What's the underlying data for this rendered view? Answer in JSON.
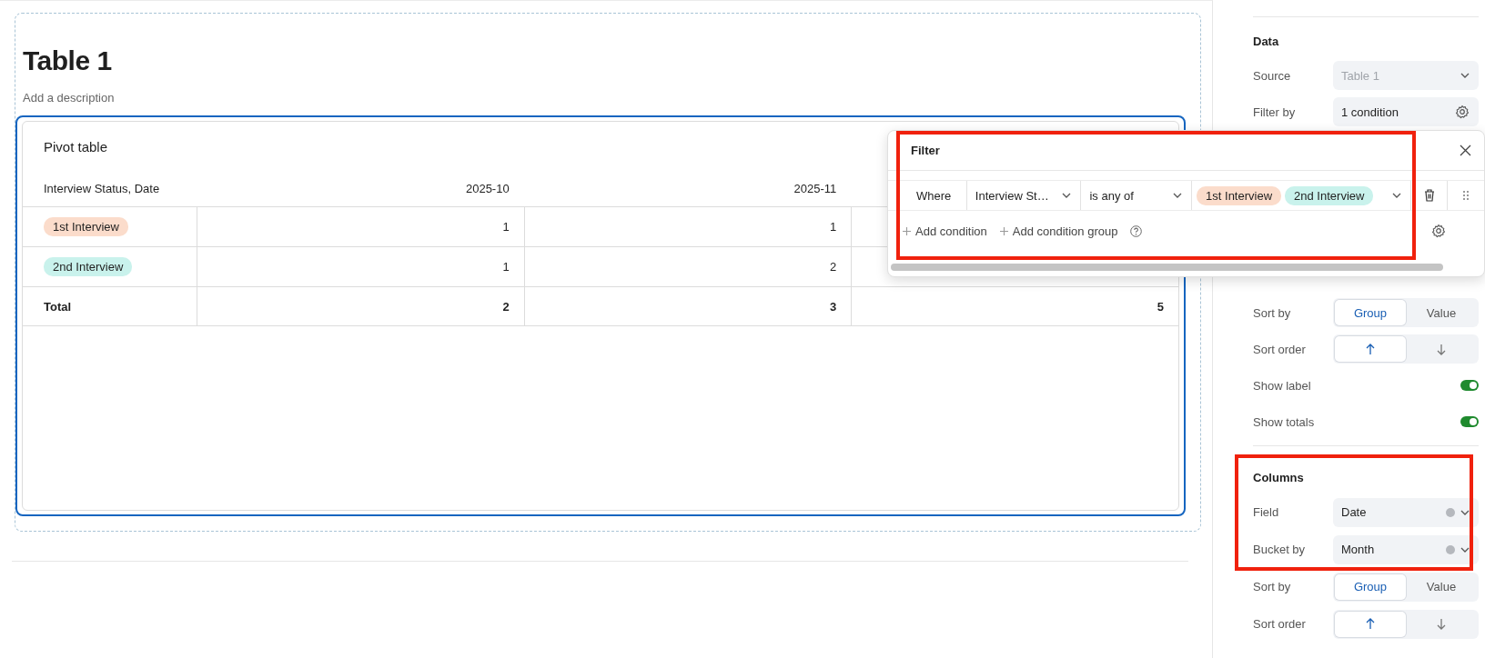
{
  "canvas": {
    "title": "Table 1",
    "description_placeholder": "Add a description"
  },
  "pivot": {
    "title": "Pivot table",
    "corner_header": "Interview Status, Date",
    "columns": [
      "2025-10",
      "2025-11"
    ],
    "rows": [
      {
        "label": "1st Interview",
        "color": "#fbdccb",
        "values": [
          "1",
          "1"
        ]
      },
      {
        "label": "2nd Interview",
        "color": "#c9f2ec",
        "values": [
          "1",
          "2"
        ]
      }
    ],
    "total": {
      "label": "Total",
      "values": [
        "2",
        "3",
        "5"
      ]
    }
  },
  "filter_popup": {
    "title": "Filter",
    "conditions": [
      {
        "prefix": "Where",
        "field": "Interview St…",
        "operator": "is any of",
        "values": [
          {
            "label": "1st Interview",
            "color": "#fbdccb"
          },
          {
            "label": "2nd Interview",
            "color": "#c9f2ec"
          }
        ]
      }
    ],
    "actions": [
      "Add condition",
      "Add condition group"
    ]
  },
  "panel": {
    "sections": [
      {
        "title": "Data",
        "settings": [
          {
            "kind": "select",
            "label": "Source",
            "value": "Table 1",
            "disabled": true
          },
          {
            "kind": "button",
            "label": "Filter by",
            "value": "1 condition"
          }
        ]
      },
      {
        "settings": [
          {
            "kind": "segmented",
            "label": "Sort by",
            "options": [
              {
                "label": "Group",
                "selected": true
              },
              {
                "label": "Value",
                "selected": false
              }
            ]
          },
          {
            "kind": "order",
            "label": "Sort order",
            "options": [
              {
                "selected": true
              },
              {
                "selected": false
              }
            ]
          },
          {
            "kind": "toggle",
            "label": "Show label",
            "on": true
          },
          {
            "kind": "toggle",
            "label": "Show totals",
            "on": true
          }
        ]
      },
      {
        "title": "Columns",
        "settings": [
          {
            "kind": "select",
            "label": "Field",
            "value": "Date",
            "clearable": true
          },
          {
            "kind": "select",
            "label": "Bucket by",
            "value": "Month",
            "clearable": true
          },
          {
            "kind": "segmented",
            "label": "Sort by",
            "options": [
              {
                "label": "Group",
                "selected": true
              },
              {
                "label": "Value",
                "selected": false
              }
            ]
          },
          {
            "kind": "order",
            "label": "Sort order",
            "options": [
              {
                "selected": true
              },
              {
                "selected": false
              }
            ]
          }
        ]
      }
    ]
  }
}
